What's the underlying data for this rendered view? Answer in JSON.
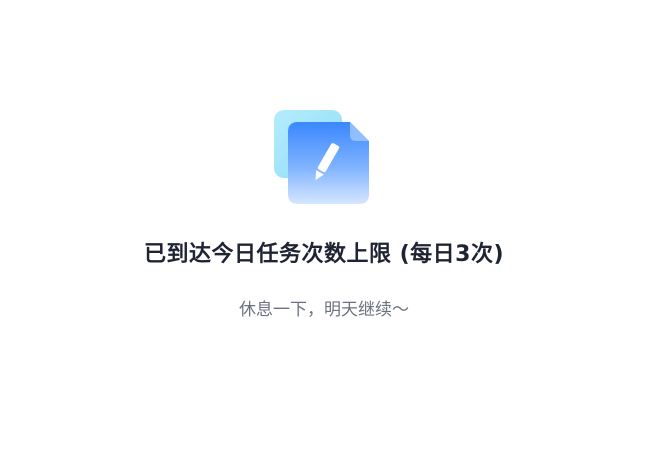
{
  "empty_state": {
    "icon": "edit-document-icon",
    "title": "已到达今日任务次数上限 (每日3次)",
    "subtitle": "休息一下，明天继续～"
  },
  "colors": {
    "title": "#1f2433",
    "subtitle": "#6b7280",
    "icon_back": "#a8e6fb",
    "icon_front_top": "#3f8dff",
    "icon_front_bottom": "#cfe0ff"
  }
}
